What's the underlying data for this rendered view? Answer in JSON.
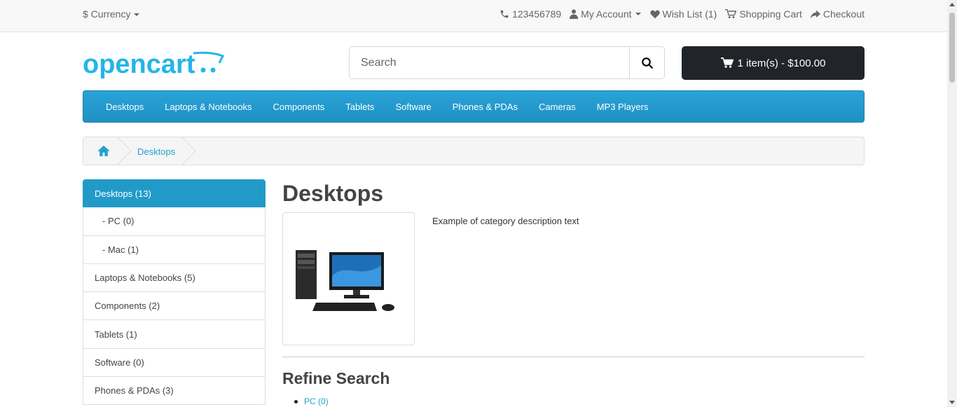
{
  "topbar": {
    "currency_label": "$ Currency",
    "phone": "123456789",
    "my_account": "My Account",
    "wish_list": "Wish List (1)",
    "shopping_cart": "Shopping Cart",
    "checkout": "Checkout"
  },
  "header": {
    "logo_text": "opencart",
    "search_placeholder": "Search",
    "cart_label": "1 item(s) - $100.00"
  },
  "menu": {
    "items": [
      "Desktops",
      "Laptops & Notebooks",
      "Components",
      "Tablets",
      "Software",
      "Phones & PDAs",
      "Cameras",
      "MP3 Players"
    ]
  },
  "breadcrumb": {
    "current": "Desktops"
  },
  "sidebar": {
    "items": [
      {
        "label": "Desktops (13)"
      },
      {
        "label": "- PC (0)"
      },
      {
        "label": "- Mac (1)"
      },
      {
        "label": "Laptops & Notebooks (5)"
      },
      {
        "label": "Components (2)"
      },
      {
        "label": "Tablets (1)"
      },
      {
        "label": "Software (0)"
      },
      {
        "label": "Phones & PDAs (3)"
      }
    ]
  },
  "content": {
    "title": "Desktops",
    "description": "Example of category description text",
    "refine_title": "Refine Search",
    "refine_items": [
      "PC (0)"
    ]
  },
  "colors": {
    "accent": "#229ac8",
    "link": "#23a1d1",
    "cart_bg": "#212529"
  }
}
